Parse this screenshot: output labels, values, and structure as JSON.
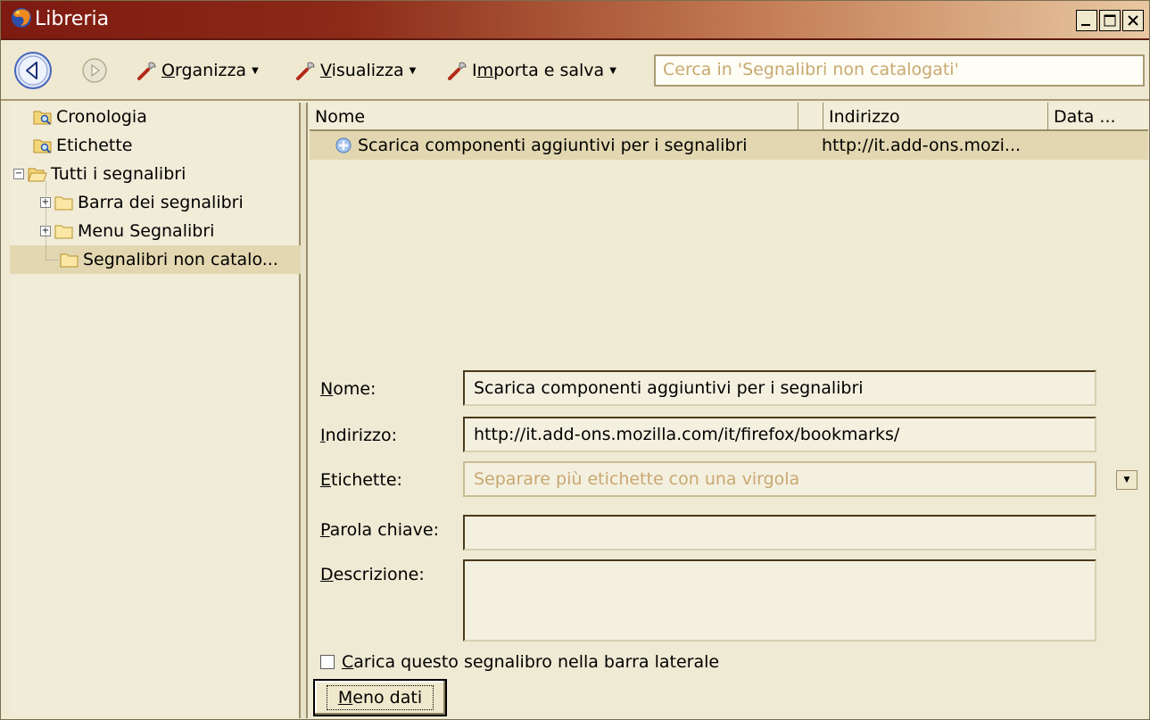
{
  "window": {
    "title": "Libreria"
  },
  "toolbar": {
    "organizza": {
      "prefix": "",
      "accel": "O",
      "rest": "rganizza"
    },
    "visualizza": {
      "prefix": "",
      "accel": "V",
      "rest": "isualizza"
    },
    "importa": {
      "prefix": "I",
      "accel": "m",
      "rest": "porta e salva"
    },
    "search_placeholder": "Cerca in 'Segnalibri non catalogati'"
  },
  "tree": {
    "items": [
      {
        "label": "Cronologia"
      },
      {
        "label": "Etichette"
      },
      {
        "label": "Tutti i segnalibri"
      },
      {
        "label": "Barra dei segnalibri"
      },
      {
        "label": "Menu Segnalibri"
      },
      {
        "label": "Segnalibri non catalo..."
      }
    ],
    "expander_plus": "+",
    "expander_minus": "−"
  },
  "list": {
    "columns": [
      "Nome",
      "",
      "Indirizzo",
      "Data ..."
    ],
    "rows": [
      {
        "name": "Scarica componenti aggiuntivi per i segnalibri",
        "url": "http://it.add-ons.mozi..."
      }
    ]
  },
  "details": {
    "nome": {
      "accel": "N",
      "rest": "ome:",
      "value": "Scarica componenti aggiuntivi per i segnalibri"
    },
    "indirizzo": {
      "accel": "I",
      "rest": "ndirizzo:",
      "value": "http://it.add-ons.mozilla.com/it/firefox/bookmarks/"
    },
    "etichette": {
      "accel": "E",
      "rest": "tichette:",
      "placeholder": "Separare più etichette con una virgola"
    },
    "parola": {
      "accel": "P",
      "rest": "arola chiave:",
      "value": ""
    },
    "descrizione": {
      "accel": "D",
      "rest": "escrizione:",
      "value": ""
    },
    "sidebar_checkbox": {
      "accel": "C",
      "rest": "arica questo segnalibro nella barra laterale"
    },
    "meno_button": {
      "accel": "M",
      "rest": "eno dati"
    }
  }
}
